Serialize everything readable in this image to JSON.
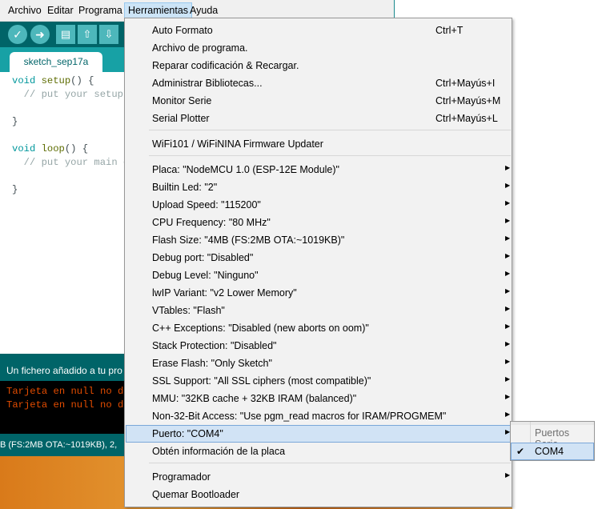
{
  "menubar": [
    "Archivo",
    "Editar",
    "Programa",
    "Herramientas",
    "Ayuda"
  ],
  "toolbar": {
    "verify_icon": "check-icon",
    "upload_icon": "arrow-right-icon",
    "new_icon": "file-icon",
    "open_icon": "arrow-up-icon",
    "save_icon": "arrow-down-icon"
  },
  "tab": {
    "name": "sketch_sep17a"
  },
  "editor": {
    "lines": [
      "void setup() {",
      "  // put your setup",
      "",
      "}",
      "",
      "void loop() {",
      "  // put your main c",
      "",
      "}"
    ]
  },
  "status": {
    "message": "Un fichero añadido a tu pro"
  },
  "console": {
    "lines": [
      "Tarjeta en null no di",
      "Tarjeta en null no di"
    ]
  },
  "footer": {
    "text": "B (FS:2MB OTA:~1019KB), 2,"
  },
  "menu": {
    "group1": [
      {
        "label": "Auto Formato",
        "shortcut": "Ctrl+T"
      },
      {
        "label": "Archivo de programa.",
        "shortcut": ""
      },
      {
        "label": "Reparar codificación & Recargar.",
        "shortcut": ""
      },
      {
        "label": "Administrar Bibliotecas...",
        "shortcut": "Ctrl+Mayús+I"
      },
      {
        "label": "Monitor Serie",
        "shortcut": "Ctrl+Mayús+M"
      },
      {
        "label": "Serial Plotter",
        "shortcut": "Ctrl+Mayús+L"
      }
    ],
    "group2": [
      {
        "label": "WiFi101 / WiFiNINA Firmware Updater"
      }
    ],
    "group3": [
      {
        "label": "Placa: \"NodeMCU 1.0 (ESP-12E Module)\""
      },
      {
        "label": "Builtin Led: \"2\""
      },
      {
        "label": "Upload Speed: \"115200\""
      },
      {
        "label": "CPU Frequency: \"80 MHz\""
      },
      {
        "label": "Flash Size: \"4MB (FS:2MB OTA:~1019KB)\""
      },
      {
        "label": "Debug port: \"Disabled\""
      },
      {
        "label": "Debug Level: \"Ninguno\""
      },
      {
        "label": "lwIP Variant: \"v2 Lower Memory\""
      },
      {
        "label": "VTables: \"Flash\""
      },
      {
        "label": "C++ Exceptions: \"Disabled (new aborts on oom)\""
      },
      {
        "label": "Stack Protection: \"Disabled\""
      },
      {
        "label": "Erase Flash: \"Only Sketch\""
      },
      {
        "label": "SSL Support: \"All SSL ciphers (most compatible)\""
      },
      {
        "label": "MMU: \"32KB cache + 32KB IRAM (balanced)\""
      },
      {
        "label": "Non-32-Bit Access: \"Use pgm_read macros for IRAM/PROGMEM\""
      },
      {
        "label": "Puerto: \"COM4\""
      },
      {
        "label": "Obtén información de la placa"
      }
    ],
    "group4": [
      {
        "label": "Programador"
      },
      {
        "label": "Quemar Bootloader"
      }
    ]
  },
  "submenu": {
    "header": "Puertos Serie",
    "item": "COM4",
    "checked": "✔"
  },
  "colors": {
    "teal": "#17a1a5",
    "dark_teal": "#006468",
    "highlight": "#d1e3f5"
  }
}
